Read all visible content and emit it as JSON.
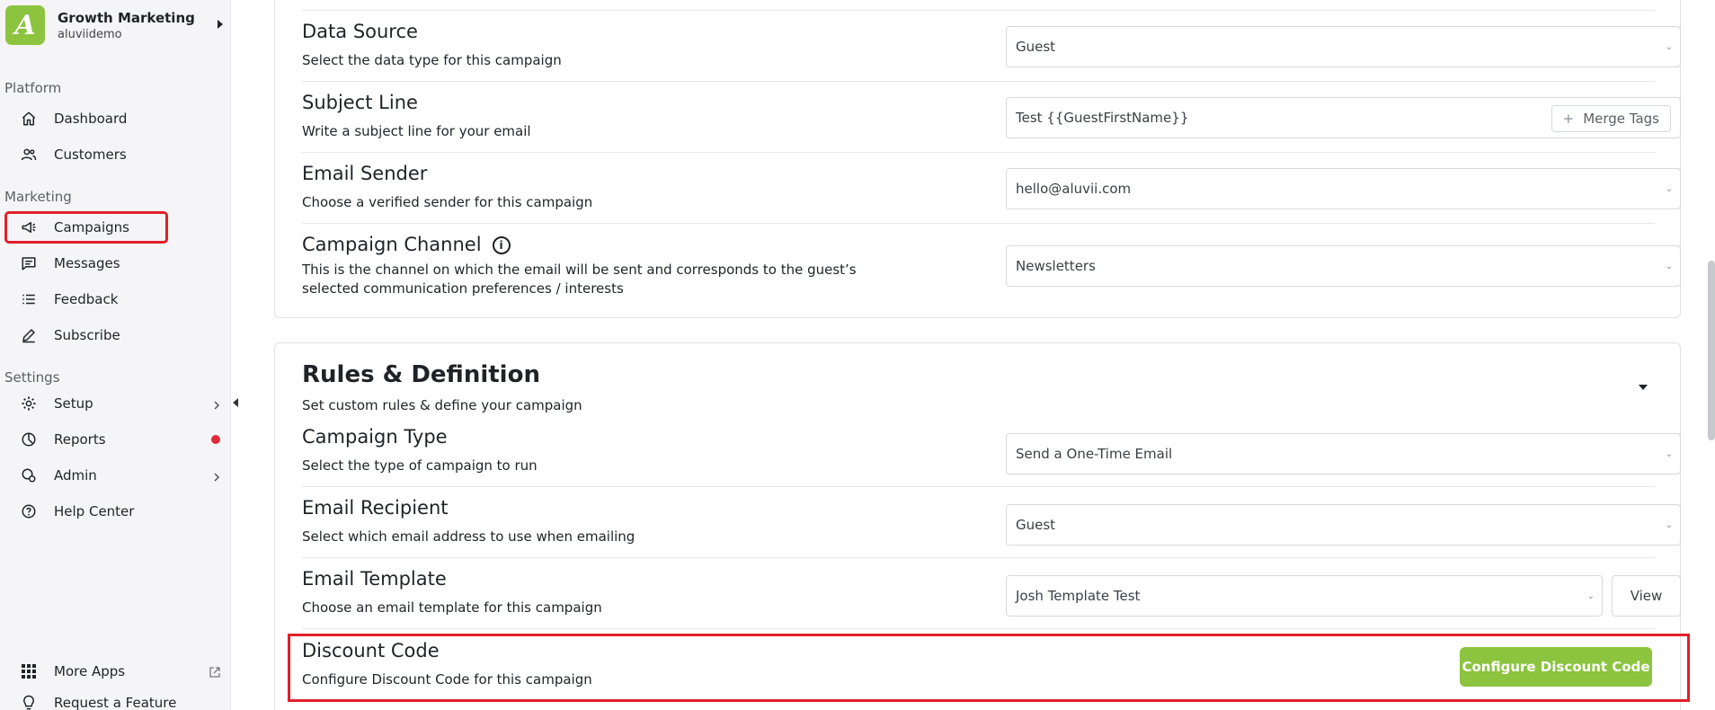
{
  "brand": {
    "title": "Growth Marketing",
    "subtitle": "aluviidemo",
    "logo_letter": "A"
  },
  "sidebar": {
    "sections": [
      {
        "label": "Platform"
      },
      {
        "label": "Marketing"
      },
      {
        "label": "Settings"
      }
    ],
    "items": [
      {
        "label": "Dashboard",
        "icon": "home-icon"
      },
      {
        "label": "Customers",
        "icon": "users-icon"
      },
      {
        "label": "Campaigns",
        "icon": "megaphone-icon",
        "active": true
      },
      {
        "label": "Messages",
        "icon": "message-icon"
      },
      {
        "label": "Feedback",
        "icon": "list-icon"
      },
      {
        "label": "Subscribe",
        "icon": "pen-icon"
      },
      {
        "label": "Setup",
        "icon": "gear-icon"
      },
      {
        "label": "Reports",
        "icon": "chart-icon"
      },
      {
        "label": "Admin",
        "icon": "admin-icon"
      },
      {
        "label": "Help Center",
        "icon": "help-icon"
      },
      {
        "label": "More Apps",
        "icon": "grid-icon"
      },
      {
        "label": "Request a Feature",
        "icon": "bulb-icon"
      }
    ]
  },
  "details": {
    "data_source": {
      "title": "Data Source",
      "desc": "Select the data type for this campaign",
      "value": "Guest"
    },
    "subject_line": {
      "title": "Subject Line",
      "desc": "Write a subject line for your email",
      "value": "Test {{GuestFirstName}}",
      "merge_label": "Merge Tags"
    },
    "email_sender": {
      "title": "Email Sender",
      "desc": "Choose a verified sender for this campaign",
      "value": "hello@aluvii.com"
    },
    "campaign_channel": {
      "title": "Campaign Channel",
      "desc": "This is the channel on which the email will be sent and corresponds to the guest’s selected communication preferences / interests",
      "value": "Newsletters"
    }
  },
  "rules": {
    "title": "Rules & Definition",
    "desc": "Set custom rules & define your campaign",
    "campaign_type": {
      "title": "Campaign Type",
      "desc": "Select the type of campaign to run",
      "value": "Send a One-Time Email"
    },
    "email_recipient": {
      "title": "Email Recipient",
      "desc": "Select which email address to use when emailing",
      "value": "Guest"
    },
    "email_template": {
      "title": "Email Template",
      "desc": "Choose an email template for this campaign",
      "value": "Josh Template Test",
      "view_label": "View"
    },
    "discount_code": {
      "title": "Discount Code",
      "desc": "Configure Discount Code for this campaign",
      "button_label": "Configure Discount Code"
    }
  },
  "colors": {
    "accent": "#8cc43f",
    "highlight": "#e0202a",
    "notification": "#e0293b"
  }
}
